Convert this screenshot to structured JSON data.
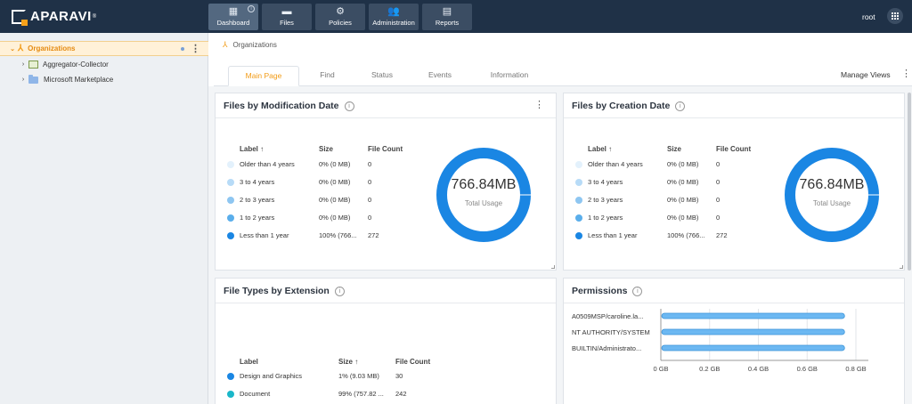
{
  "app": {
    "logo_text": "APARAVI",
    "user": "root"
  },
  "nav": {
    "items": [
      {
        "label": "Dashboard",
        "icon": "dashboard-icon",
        "active": true
      },
      {
        "label": "Files",
        "icon": "folder-icon",
        "active": false
      },
      {
        "label": "Policies",
        "icon": "gear-icon",
        "active": false
      },
      {
        "label": "Administration",
        "icon": "users-icon",
        "active": false
      },
      {
        "label": "Reports",
        "icon": "report-icon",
        "active": false
      }
    ]
  },
  "sidebar": {
    "tree": [
      {
        "label": "Organizations",
        "selected": true
      },
      {
        "label": "Aggregator-Collector"
      },
      {
        "label": "Microsoft Marketplace"
      }
    ]
  },
  "breadcrumb": "Organizations",
  "tabs": [
    "Main Page",
    "Find",
    "Status",
    "Events",
    "Information"
  ],
  "manage_views": "Manage Views",
  "cards": {
    "mod_date": {
      "title": "Files by Modification Date",
      "headers": {
        "label": "Label ↑",
        "size": "Size",
        "count": "File Count"
      },
      "rows": [
        {
          "label": "Older than 4 years",
          "size": "0% (0 MB)",
          "count": "0",
          "color": "#e3f1fc"
        },
        {
          "label": "3 to 4 years",
          "size": "0% (0 MB)",
          "count": "0",
          "color": "#b7dbf7"
        },
        {
          "label": "2 to 3 years",
          "size": "0% (0 MB)",
          "count": "0",
          "color": "#8ec6f1"
        },
        {
          "label": "1 to 2 years",
          "size": "0% (0 MB)",
          "count": "0",
          "color": "#5aaeeb"
        },
        {
          "label": "Less than 1 year",
          "size": "100% (766...",
          "count": "272",
          "color": "#1a86e3"
        }
      ],
      "total": "766.84MB",
      "total_label": "Total Usage"
    },
    "create_date": {
      "title": "Files by Creation Date",
      "headers": {
        "label": "Label ↑",
        "size": "Size",
        "count": "File Count"
      },
      "rows": [
        {
          "label": "Older than 4 years",
          "size": "0% (0 MB)",
          "count": "0",
          "color": "#e3f1fc"
        },
        {
          "label": "3 to 4 years",
          "size": "0% (0 MB)",
          "count": "0",
          "color": "#b7dbf7"
        },
        {
          "label": "2 to 3 years",
          "size": "0% (0 MB)",
          "count": "0",
          "color": "#8ec6f1"
        },
        {
          "label": "1 to 2 years",
          "size": "0% (0 MB)",
          "count": "0",
          "color": "#5aaeeb"
        },
        {
          "label": "Less than 1 year",
          "size": "100% (766...",
          "count": "272",
          "color": "#1a86e3"
        }
      ],
      "total": "766.84MB",
      "total_label": "Total Usage"
    },
    "file_types": {
      "title": "File Types by Extension",
      "headers": {
        "label": "Label",
        "size": "Size ↑",
        "count": "File Count"
      },
      "rows": [
        {
          "label": "Design and Graphics",
          "size": "1% (9.03 MB)",
          "count": "30",
          "color": "#1a86e3"
        },
        {
          "label": "Document",
          "size": "99% (757.82 ...",
          "count": "242",
          "color": "#1ab7c9"
        }
      ]
    },
    "permissions": {
      "title": "Permissions",
      "chart_data": {
        "type": "bar",
        "orientation": "horizontal",
        "categories": [
          "A0509MSP/caroline.la...",
          "NT AUTHORITY/SYSTEM",
          "BUILTIN/Administrato..."
        ],
        "values": [
          0.75,
          0.75,
          0.75
        ],
        "xlim": [
          0,
          0.8
        ],
        "ticks": [
          "0 GB",
          "0.2 GB",
          "0.4 GB",
          "0.6 GB",
          "0.8 GB"
        ],
        "bar_color": "#6cb8f2"
      }
    }
  }
}
